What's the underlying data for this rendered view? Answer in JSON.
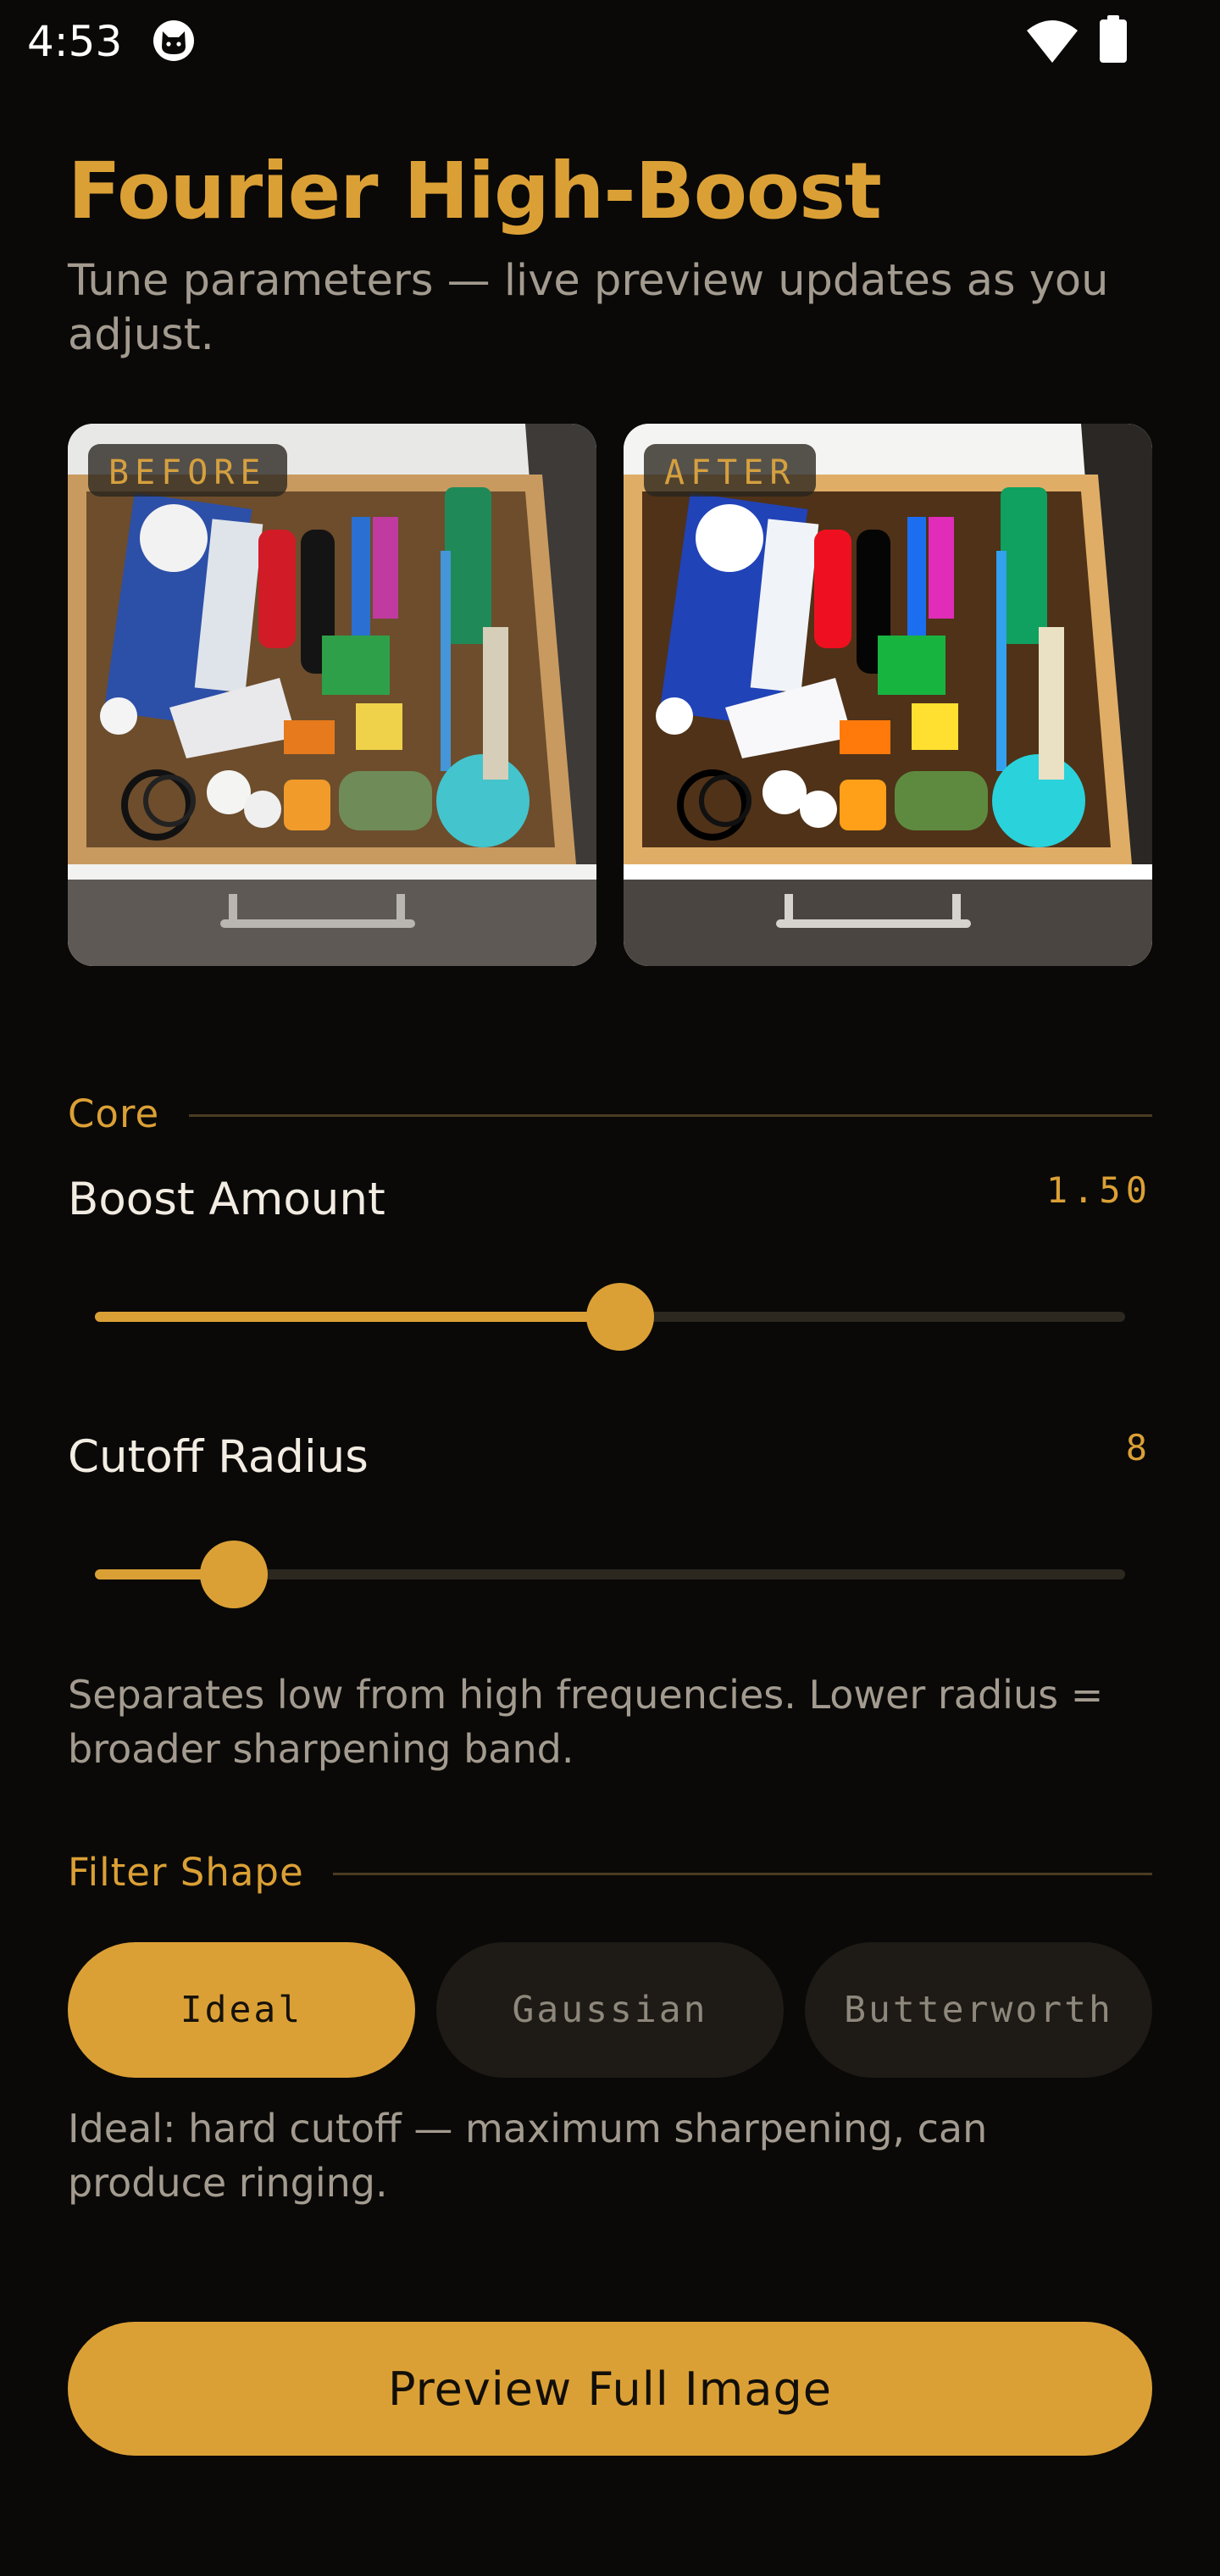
{
  "status_bar": {
    "time": "4:53",
    "icons": [
      "cat-notification-icon",
      "wifi-icon",
      "battery-icon"
    ]
  },
  "header": {
    "title": "Fourier High-Boost",
    "subtitle": "Tune parameters — live preview updates as you adjust."
  },
  "preview": {
    "before_label": "BEFORE",
    "after_label": "AFTER"
  },
  "core_section": {
    "label": "Core",
    "boost": {
      "label": "Boost Amount",
      "value": "1.50",
      "position_fraction": 0.51
    },
    "cutoff": {
      "label": "Cutoff Radius",
      "value": "8",
      "position_fraction": 0.135
    },
    "help": "Separates low from high frequencies. Lower radius = broader sharpening band."
  },
  "filter_section": {
    "label": "Filter Shape",
    "options": [
      "Ideal",
      "Gaussian",
      "Butterworth"
    ],
    "selected": "Ideal",
    "help": "Ideal: hard cutoff — maximum sharpening, can produce ringing."
  },
  "cta": {
    "label": "Preview Full Image"
  },
  "colors": {
    "background": "#0a0908",
    "accent": "#dba035",
    "muted_text": "#a39b8f",
    "track": "#2c2820",
    "inactive_chip": "#1e1b16"
  }
}
